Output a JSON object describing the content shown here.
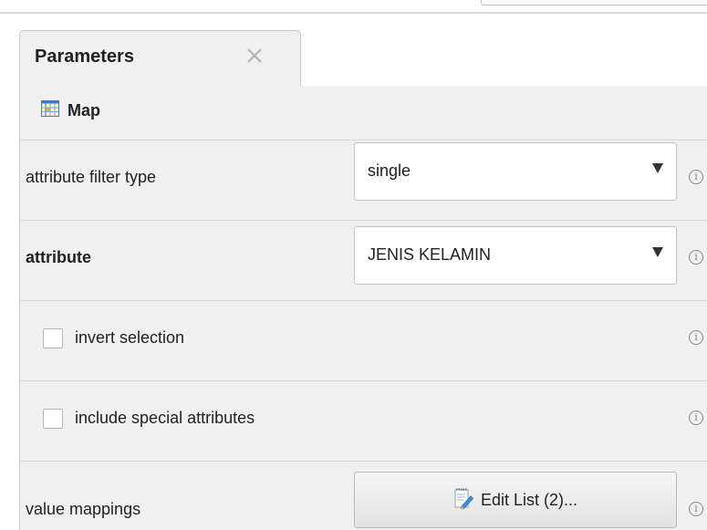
{
  "tab": {
    "title": "Parameters",
    "close_symbol": "✕",
    "close_icon": "close-icon"
  },
  "operator": {
    "name": "Map",
    "icon": "map-operator-icon"
  },
  "params": {
    "filter_type": {
      "label": "attribute filter type",
      "value": "single"
    },
    "attribute": {
      "label": "attribute",
      "value": "JENIS KELAMIN"
    },
    "invert_selection": {
      "label": "invert selection",
      "checked": false
    },
    "include_special": {
      "label": "include special attributes",
      "checked": false
    },
    "value_mappings": {
      "label": "value mappings",
      "button_label": "Edit List (2)...",
      "button_icon": "edit-list-icon"
    }
  },
  "info_symbol": "i",
  "colors": {
    "panel_background": "#f0f0f0",
    "border": "#c8c8c8",
    "text": "#222222",
    "info_icon": "#8a8a8a"
  }
}
